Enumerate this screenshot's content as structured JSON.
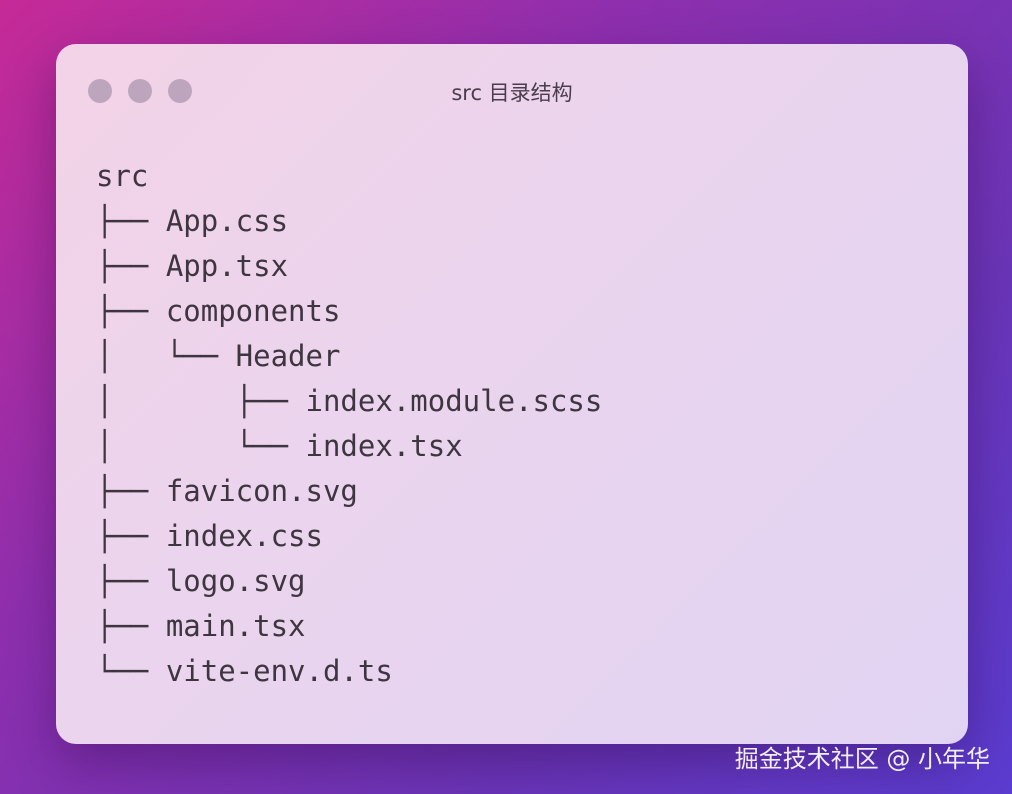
{
  "window": {
    "title": "src 目录结构",
    "colors": {
      "traffic_light": "#bda6bd",
      "text": "#3e3540"
    }
  },
  "tree": {
    "lines": [
      "src",
      "├── App.css",
      "├── App.tsx",
      "├── components",
      "│   └── Header",
      "│       ├── index.module.scss",
      "│       └── index.tsx",
      "├── favicon.svg",
      "├── index.css",
      "├── logo.svg",
      "├── main.tsx",
      "└── vite-env.d.ts"
    ]
  },
  "watermark": "掘金技术社区 @ 小年华"
}
